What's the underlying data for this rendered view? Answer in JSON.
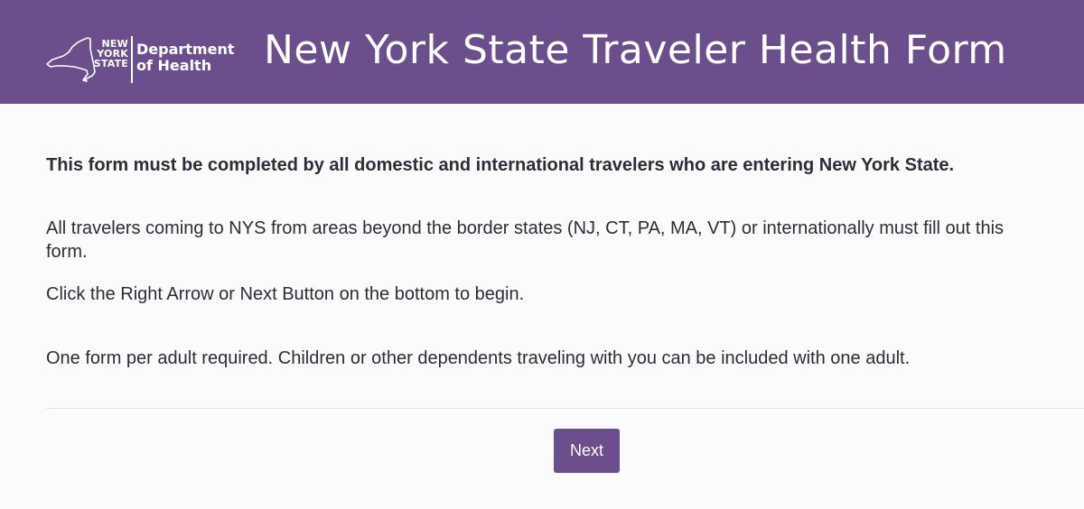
{
  "header": {
    "logo": {
      "state_lines": [
        "NEW",
        "YORK",
        "STATE"
      ],
      "department_lines": [
        "Department",
        "of Health"
      ],
      "icon": "new-york-state-outline-icon"
    },
    "title": "New York State Traveler Health Form"
  },
  "main": {
    "lead": "This form must be completed by all domestic and international travelers who are entering New York State.",
    "paragraphs": [
      "All travelers coming to NYS from areas beyond the border states (NJ, CT, PA, MA, VT) or internationally must fill out this form.",
      "Click the Right Arrow or Next Button on the bottom to begin.",
      "One form per adult required. Children or other dependents traveling with you can be included with one adult."
    ]
  },
  "footer": {
    "next_label": "Next"
  },
  "colors": {
    "brand": "#6a4f8c",
    "text": "#2b2d3a",
    "background": "#fbfbfb",
    "white": "#ffffff"
  }
}
